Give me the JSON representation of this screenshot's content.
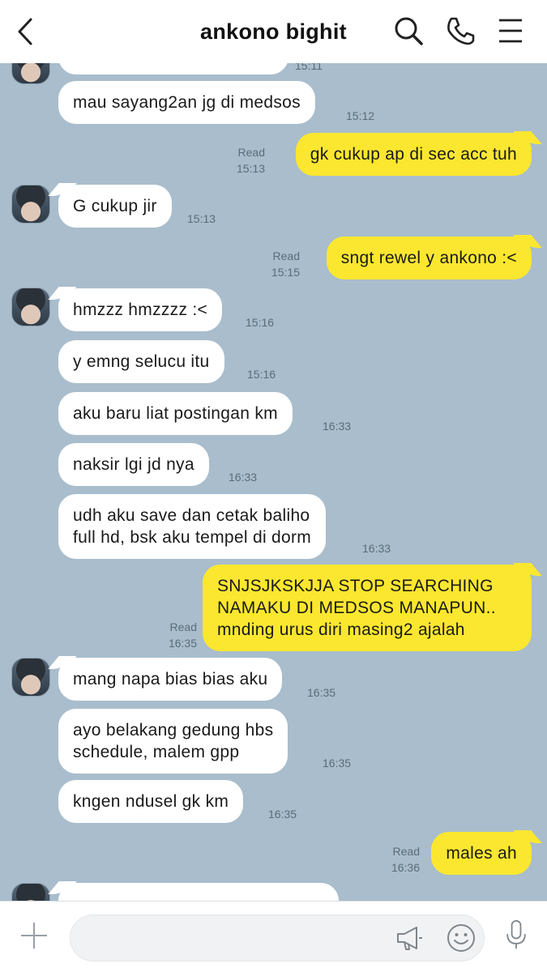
{
  "header": {
    "title": "ankono bighit"
  },
  "input": {
    "placeholder": ""
  },
  "messages": [
    {
      "id": "m0",
      "side": "in",
      "text": "",
      "time": "15:11"
    },
    {
      "id": "m1",
      "side": "in",
      "text": "mau sayang2an jg di medsos",
      "time": "15:12"
    },
    {
      "id": "m2",
      "side": "out",
      "text": "gk cukup ap di sec acc tuh",
      "time": "15:13",
      "status": "Read"
    },
    {
      "id": "m3",
      "side": "in",
      "text": "G cukup jir",
      "time": "15:13"
    },
    {
      "id": "m4",
      "side": "out",
      "text": "sngt rewel y ankono :<",
      "time": "15:15",
      "status": "Read"
    },
    {
      "id": "m5",
      "side": "in",
      "text": "hmzzz hmzzzz :<",
      "time": "15:16"
    },
    {
      "id": "m6",
      "side": "in",
      "text": "y emng selucu itu",
      "time": "15:16"
    },
    {
      "id": "m7",
      "side": "in",
      "text": "aku baru liat postingan km",
      "time": "16:33"
    },
    {
      "id": "m8",
      "side": "in",
      "text": "naksir lgi jd nya",
      "time": "16:33"
    },
    {
      "id": "m9",
      "side": "in",
      "text": "udh aku save dan cetak baliho\nfull hd, bsk aku tempel di dorm",
      "time": "16:33"
    },
    {
      "id": "m10",
      "side": "out",
      "text": "SNJSJKSKJJA STOP SEARCHING\nNAMAKU DI MEDSOS MANAPUN..\nmnding urus diri masing2 ajalah",
      "time": "16:35",
      "status": "Read"
    },
    {
      "id": "m11",
      "side": "in",
      "text": "mang napa bias bias aku",
      "time": "16:35"
    },
    {
      "id": "m12",
      "side": "in",
      "text": "ayo belakang gedung hbs\nschedule, malem gpp",
      "time": "16:35"
    },
    {
      "id": "m13",
      "side": "in",
      "text": "kngen ndusel gk km",
      "time": "16:35"
    },
    {
      "id": "m14",
      "side": "out",
      "text": "males ah",
      "time": "16:36",
      "status": "Read"
    },
    {
      "id": "m15",
      "side": "in",
      "text": "",
      "time": ""
    }
  ],
  "icons": {
    "back": "chevron-left-icon",
    "search": "search-icon",
    "call": "phone-icon",
    "menu": "menu-icon",
    "add": "plus-icon",
    "announce": "megaphone-icon",
    "emoji": "smiley-icon",
    "voice": "microphone-icon"
  },
  "colors": {
    "chat_background": "#a9bdcc",
    "outgoing_bubble": "#fbe72f",
    "incoming_bubble": "#ffffff"
  }
}
